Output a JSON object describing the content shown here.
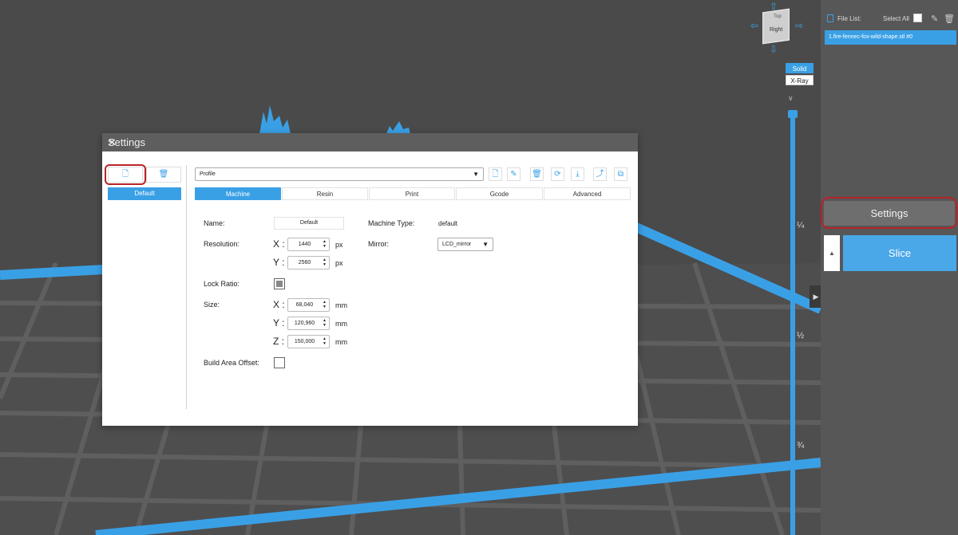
{
  "viewport": {
    "view_cube_label": "Right",
    "view_cube_top": "Top",
    "view_modes": {
      "solid": "Solid",
      "xray": "X-Ray",
      "active": "Solid"
    },
    "layer_ticks": [
      "¼",
      "½",
      "¾"
    ]
  },
  "file_list": {
    "title": "File List:",
    "select_all": "Select All",
    "items": [
      "1.fire-fennec-fox-wild-shape.stl #0"
    ]
  },
  "side_panel": {
    "settings_button": "Settings",
    "slice_button": "Slice",
    "slice_toggle": "▲"
  },
  "dialog": {
    "title": "Settings",
    "close": "✕",
    "profiles": [
      "Default"
    ],
    "profile_select": "Profile",
    "tabs": [
      "Machine",
      "Resin",
      "Print",
      "Gcode",
      "Advanced"
    ],
    "active_tab": "Machine",
    "machine": {
      "name_label": "Name:",
      "name_value": "Default",
      "machine_type_label": "Machine Type:",
      "machine_type_value": "default",
      "resolution_label": "Resolution:",
      "res_x": "1440",
      "res_y": "2560",
      "res_unit": "px",
      "mirror_label": "Mirror:",
      "mirror_value": "LCD_mirror",
      "lock_ratio_label": "Lock Ratio:",
      "lock_ratio_checked": true,
      "size_label": "Size:",
      "size_x": "68,040",
      "size_y": "120,960",
      "size_z": "150,000",
      "size_unit": "mm",
      "build_offset_label": "Build Area Offset:",
      "build_offset_checked": false,
      "axis_x": "X :",
      "axis_y": "Y :",
      "axis_z": "Z :"
    }
  },
  "colors": {
    "accent": "#3aa0e6",
    "highlight_outline": "#b8232a",
    "viewport_bg": "#4a4a4a"
  }
}
